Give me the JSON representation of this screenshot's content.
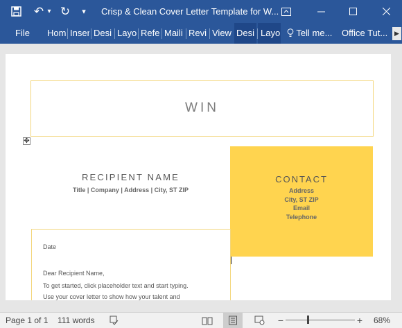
{
  "titlebar": {
    "save_icon": "save-icon",
    "undo_glyph": "↶",
    "undo_dropdown_glyph": "▾",
    "redo_glyph": "↻",
    "customize_glyph": "▾",
    "title": "Crisp & Clean Cover Letter Template for W...",
    "ribbon_display_glyph": "▭",
    "minimize_glyph": "—",
    "maximize_glyph": "☐",
    "close_glyph": "✕",
    "color": "#2b579a"
  },
  "ribbon": {
    "tabs": [
      "File",
      "Hom",
      "Inser",
      "Desi",
      "Layo",
      "Refe",
      "Maili",
      "Revi",
      "View",
      "Desi",
      "Layo"
    ],
    "tell_me": "Tell me...",
    "tell_me_icon": "lightbulb-icon",
    "account": "Office Tut...",
    "scroll_glyph": "▶"
  },
  "document": {
    "name": "WIN",
    "recipient_name": "RECIPIENT NAME",
    "recipient_details": "Title | Company | Address | City, ST ZIP",
    "contact_title": "CONTACT",
    "contact_lines": [
      "Address",
      "City, ST ZIP",
      "Email",
      "Telephone"
    ],
    "date": "Date",
    "greeting": "Dear Recipient Name,",
    "body_line1": "To get started, click placeholder text and start typing.",
    "body_line2": "Use your cover letter to show how your talent and",
    "accent_color": "#ffd44f",
    "move_handle_glyph": "✥"
  },
  "statusbar": {
    "page": "Page 1 of 1",
    "words": "111 words",
    "zoom_minus": "−",
    "zoom_plus": "+",
    "zoom": "68%",
    "zoom_level_percent": 68
  }
}
